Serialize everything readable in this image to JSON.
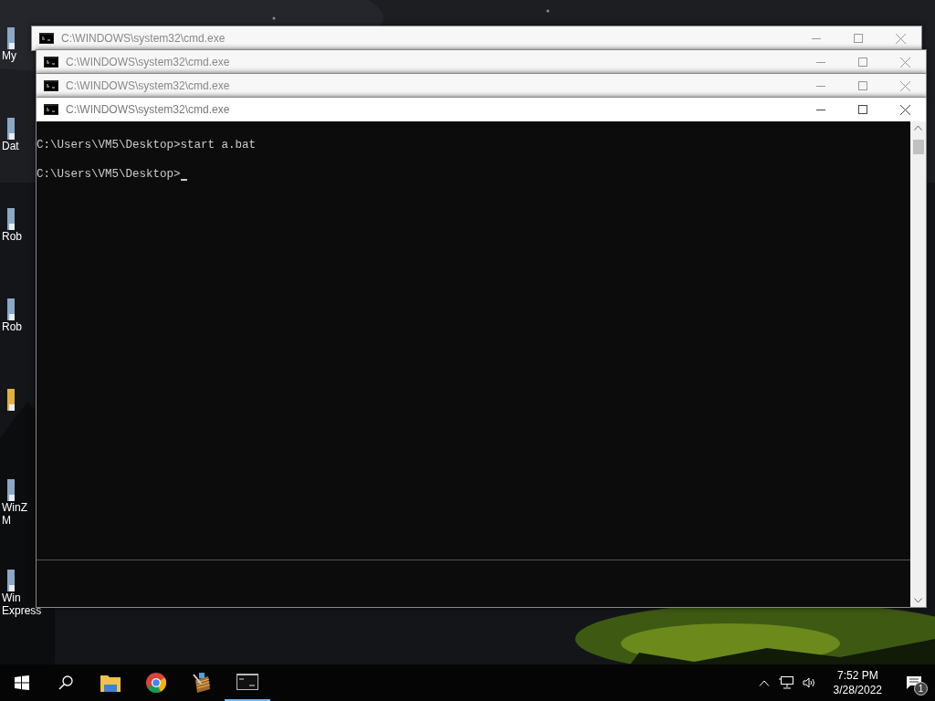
{
  "desktop_icons": [
    {
      "kind": "shortcut",
      "label_lines": [
        "My"
      ]
    },
    {
      "kind": "shortcut",
      "label_lines": [
        "Dat"
      ]
    },
    {
      "kind": "shortcut",
      "label_lines": [
        "Rob"
      ]
    },
    {
      "kind": "shortcut",
      "label_lines": [
        "Rob"
      ]
    },
    {
      "kind": "folder"
    },
    {
      "kind": "shortcut",
      "label_lines": [
        "WinZ",
        "M"
      ]
    },
    {
      "kind": "shortcut",
      "label_lines": [
        "Win",
        "Express"
      ]
    }
  ],
  "windows": [
    {
      "title": "C:\\WINDOWS\\system32\\cmd.exe",
      "active": false
    },
    {
      "title": "C:\\WINDOWS\\system32\\cmd.exe",
      "active": false
    },
    {
      "title": "C:\\WINDOWS\\system32\\cmd.exe",
      "active": false
    },
    {
      "title": "C:\\WINDOWS\\system32\\cmd.exe",
      "active": true,
      "console_lines": [
        "C:\\Users\\VM5\\Desktop>start a.bat",
        "C:\\Users\\VM5\\Desktop>"
      ]
    }
  ],
  "taskbar": {
    "apps": [
      {
        "kind": "folder",
        "running": false
      },
      {
        "kind": "chrome",
        "running": false
      },
      {
        "kind": "archive",
        "running": false
      },
      {
        "kind": "console",
        "running": true
      }
    ],
    "time": "7:52 PM",
    "date": "3/28/2022",
    "notification_count": "1"
  }
}
